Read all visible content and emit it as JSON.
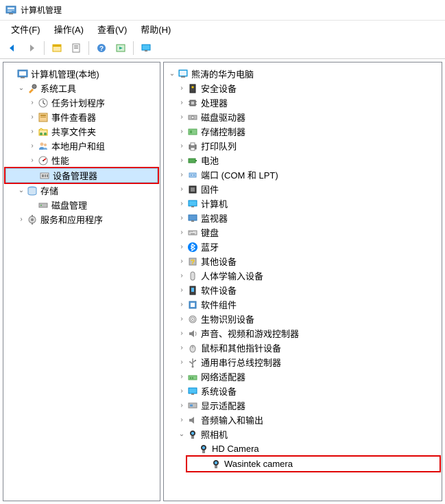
{
  "titleBar": {
    "title": "计算机管理"
  },
  "menu": {
    "file": "文件(F)",
    "action": "操作(A)",
    "view": "查看(V)",
    "help": "帮助(H)"
  },
  "leftTree": {
    "root": "计算机管理(本地)",
    "systemTools": "系统工具",
    "taskScheduler": "任务计划程序",
    "eventViewer": "事件查看器",
    "sharedFolders": "共享文件夹",
    "localUsersGroups": "本地用户和组",
    "performance": "性能",
    "deviceManager": "设备管理器",
    "storage": "存储",
    "diskManagement": "磁盘管理",
    "servicesApps": "服务和应用程序"
  },
  "rightTree": {
    "computerName": "熊涛的华为电脑",
    "securityDevices": "安全设备",
    "processors": "处理器",
    "diskDrives": "磁盘驱动器",
    "storageControllers": "存储控制器",
    "printQueues": "打印队列",
    "batteries": "电池",
    "ports": "端口 (COM 和 LPT)",
    "firmware": "固件",
    "computer": "计算机",
    "monitors": "监视器",
    "keyboards": "键盘",
    "bluetooth": "蓝牙",
    "otherDevices": "其他设备",
    "hid": "人体学输入设备",
    "softwareDevices": "软件设备",
    "softwareComponents": "软件组件",
    "biometric": "生物识别设备",
    "audio": "声音、视频和游戏控制器",
    "mice": "鼠标和其他指针设备",
    "usb": "通用串行总线控制器",
    "networkAdapters": "网络适配器",
    "systemDevices": "系统设备",
    "displayAdapters": "显示适配器",
    "audioIO": "音频输入和输出",
    "cameras": "照相机",
    "hdCamera": "HD Camera",
    "wasintekCamera": "Wasintek camera"
  }
}
